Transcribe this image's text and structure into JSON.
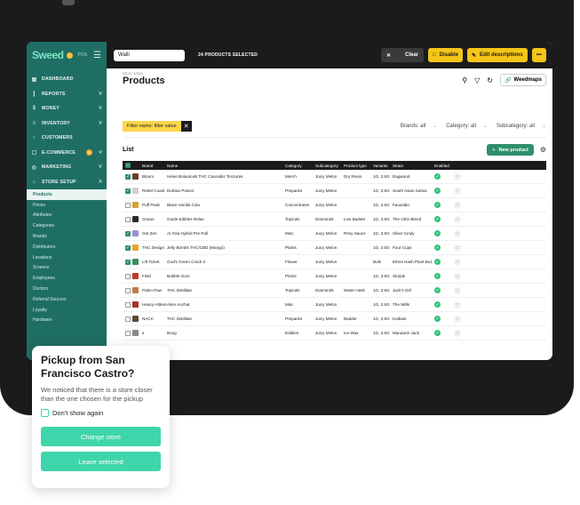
{
  "app": {
    "logo": "Sweed",
    "logo_sub": "POS"
  },
  "sidebar": {
    "items": [
      {
        "label": "DASHBOARD",
        "icon": "grid-icon",
        "chevron": false
      },
      {
        "label": "REPORTS",
        "icon": "bar-chart-icon",
        "chevron": true
      },
      {
        "label": "MONEY",
        "icon": "dollar-icon",
        "chevron": true
      },
      {
        "label": "INVENTORY",
        "icon": "list-icon",
        "chevron": true
      },
      {
        "label": "CUSTOMERS",
        "icon": "person-icon",
        "chevron": false
      },
      {
        "label": "E-COMMERCE",
        "icon": "bag-icon",
        "chevron": true,
        "badge": "5"
      },
      {
        "label": "MARKETING",
        "icon": "target-icon",
        "chevron": true
      },
      {
        "label": "STORE SETUP",
        "icon": "store-icon",
        "chevron": true,
        "expanded": true
      }
    ],
    "subitems": [
      "Products",
      "Prices",
      "Attributes",
      "Categories",
      "Brands",
      "Distributors",
      "Locations",
      "Screens",
      "Employees",
      "Doctors",
      "Referral Sources",
      "Loyalty",
      "Hardware"
    ],
    "active_subitem": "Products"
  },
  "topbar": {
    "store_value": "Walli",
    "selected_count": "24 PRODUCTS SELECTED",
    "clear_label": "Clear",
    "disable_label": "Disable",
    "edit_label": "Edit descriptions",
    "more_label": "•••"
  },
  "page": {
    "breadcrumb": "Store setup",
    "title": "Products",
    "weedmaps_label": "Weedmaps",
    "filter_chip": "Filter name: filter value",
    "brands_dd": "Brands: all",
    "category_dd": "Category: all",
    "subcategory_dd": "Subcategory: all",
    "list_title": "List",
    "new_product_label": "New product"
  },
  "table": {
    "headers": [
      "",
      "",
      "Brand",
      "Name",
      "Category",
      "Subcategory",
      "Product type",
      "Variants",
      "Strain",
      "Enabled",
      ""
    ],
    "rows": [
      {
        "checked": true,
        "thumb": "#6b3f2a",
        "brand": "Bloom",
        "name": "Heise Botanicals THC Cannabis Tinctures",
        "category": "Merch",
        "subcategory": "Juicy Melon",
        "type": "Dry Resin",
        "variants": "1G, 3.5G",
        "strain": "Dagwood"
      },
      {
        "checked": true,
        "thumb": "#cfcfcf",
        "brand": "Rebel Coast",
        "name": "Durban Poison",
        "category": "Prepacks",
        "subcategory": "Juicy Melon",
        "type": "",
        "variants": "1G, 3.5G",
        "strain": "South Asian Sativa"
      },
      {
        "checked": false,
        "thumb": "#d8a13a",
        "brand": "Puff Peak",
        "name": "Blaze Vanilla Cola",
        "category": "Concentrates",
        "subcategory": "Juicy Melon",
        "type": "",
        "variants": "1G, 3.5G",
        "strain": "Fausaldo"
      },
      {
        "checked": false,
        "thumb": "#2b2b2b",
        "brand": "Ocean",
        "name": "Guide Edibles Relax",
        "category": "Topicals",
        "subcategory": "Diamonds",
        "type": "Live Badder",
        "variants": "1G, 3.5G",
        "strain": "The CBG Blend"
      },
      {
        "checked": true,
        "thumb": "#9c8fd8",
        "brand": "Get Zen",
        "name": "Al Yola Hybrid Pre Roll",
        "category": "Misc",
        "subcategory": "Juicy Melon",
        "type": "Peny Sauce",
        "variants": "1G, 3.5G",
        "strain": "Silver Cindy"
      },
      {
        "checked": true,
        "thumb": "#e6a830",
        "brand": "THC Design",
        "name": "Jelly Bombs THC/CBD (Mango)",
        "category": "Plants",
        "subcategory": "Juicy Melon",
        "type": "",
        "variants": "1G, 3.5G",
        "strain": "Four Cups"
      },
      {
        "checked": true,
        "thumb": "#3e8e5a",
        "brand": "Lift Ticket",
        "name": "God's Green Crack II",
        "category": "Flower",
        "subcategory": "Juicy Melon",
        "type": "",
        "variants": "Bulk",
        "strain": "Ethos Hash Plant Bx1"
      },
      {
        "checked": false,
        "thumb": "#c0392b",
        "brand": "Field",
        "name": "Bubble Gum",
        "category": "Plants",
        "subcategory": "Juicy Melon",
        "type": "",
        "variants": "1G, 3.5G",
        "strain": "Slurple"
      },
      {
        "checked": false,
        "thumb": "#c07a4a",
        "brand": "Paleo Paw",
        "name": "THC Distillate",
        "category": "Topicals",
        "subcategory": "Diamonds",
        "type": "Water Hash",
        "variants": "1G, 3.5G",
        "strain": "Jack's Girl"
      },
      {
        "checked": false,
        "thumb": "#a8322b",
        "brand": "Heavy Hitters",
        "name": "Alien Aochat",
        "category": "Misc",
        "subcategory": "Juicy Melon",
        "type": "",
        "variants": "1G, 3.5G",
        "strain": "The Wills"
      },
      {
        "checked": false,
        "thumb": "#5a4a3a",
        "brand": "NACC",
        "name": "THC Distillate",
        "category": "Prepacks",
        "subcategory": "Juicy Melon",
        "type": "Badder",
        "variants": "1G, 3.5G",
        "strain": "Kodiato"
      },
      {
        "checked": false,
        "thumb": "#8a8a8a",
        "brand": "s",
        "name": "Bong",
        "category": "Edibles",
        "subcategory": "Juicy Melon",
        "type": "Ice Wax",
        "variants": "1G, 3.5G",
        "strain": "Mandarin Jack"
      }
    ]
  },
  "popup": {
    "title": "Pickup from San Francisco Castro?",
    "body": "We noticed that there is a store closer than the one chosen for the pickup",
    "checkbox_label": "Don't show again",
    "primary_label": "Change store",
    "secondary_label": "Leave selected"
  },
  "colors": {
    "sidebar": "#1f6e63",
    "accent": "#2f8f6b",
    "yellow": "#f5c518",
    "popup_button": "#3fd5aa"
  }
}
